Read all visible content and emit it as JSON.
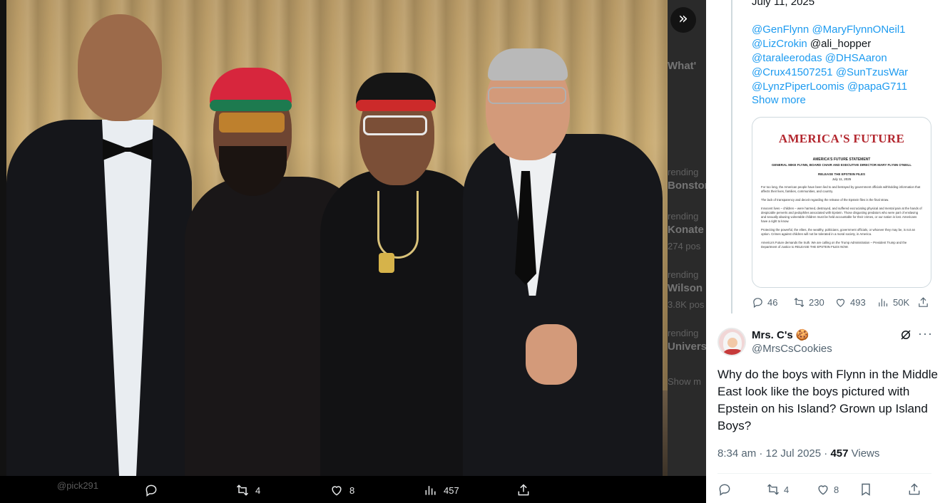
{
  "viewer": {
    "expand_icon": "chevrons-right-icon",
    "background_ghost": {
      "whats": "What'",
      "items": [
        {
          "line1": "rending",
          "line2": "Bonston"
        },
        {
          "line1": "rending",
          "line2": "Konate",
          "line3": "274 pos"
        },
        {
          "line1": "rending",
          "line2": "Wilson",
          "line3": "3.8K pos"
        },
        {
          "line1": "rending",
          "line2": "Univers"
        }
      ],
      "show": "Show m",
      "handle": "@pick291"
    },
    "bottom_bar": {
      "reply_icon": "reply-icon",
      "reply_count": "",
      "retweet_icon": "retweet-icon",
      "retweet_count": "4",
      "like_icon": "heart-icon",
      "like_count": "8",
      "views_icon": "views-icon",
      "views_count": "457",
      "share_icon": "share-icon"
    }
  },
  "parent_tweet": {
    "date": "July 11, 2025",
    "mentions": [
      "@GenFlynn",
      "@MaryFlynnONeil1",
      "@LizCrokin",
      "@ali_hopper",
      "@taraleerodas",
      "@DHSAaron",
      "@Crux41507251",
      "@SunTzusWar",
      "@LynzPiperLoomis",
      "@papaG711"
    ],
    "show_more": "Show more",
    "card": {
      "logo": "AMERICA'S FUTURE",
      "heading1": "AMERICA'S FUTURE STATEMENT",
      "heading2": "GENERAL MIKE FLYNN, BOARD CHAIR AND EXECUTIVE DIRECTOR MARY FLYNN O'NEILL",
      "heading3": "RELEASE THE EPSTEIN FILES",
      "heading4": "July 11, 2025",
      "paragraphs": [
        "For too long, the American people have been lied to and betrayed by government officials withholding information that affects their lives, families, communities, and country.",
        "The lack of transparency and deceit regarding the release of the Epstein files is the final straw.",
        "Innocent lives – children – were harmed, destroyed, and suffered excruciating physical and mental pain at the hands of despicable perverts and pedophiles associated with Epstein. Those disgusting predators who were part of enslaving and sexually abusing vulnerable children must be held accountable for their crimes, or our nation is lost. Americans have a right to know.",
        "Protecting the powerful, the elites, the wealthy, politicians, government officials, or whoever they may be, is not an option. Crimes against children will not be tolerated in a moral society, in America.",
        "America's Future demands the truth. We are calling on the Trump Administration – President Trump and the Department of Justice to RELEASE THE EPSTEIN FILES NOW."
      ]
    },
    "stats": {
      "replies": "46",
      "retweets": "230",
      "likes": "493",
      "views": "50K"
    }
  },
  "reply": {
    "name": "Mrs. C's 🍪",
    "handle": "@MrsCsCookies",
    "text": "Why do the boys with Flynn in the Middle East look like the boys pictured with Epstein on his Island? Grown up Island Boys?",
    "time": "8:34 am · 12 Jul 2025 · ",
    "views_num": "457",
    "views_label": " Views",
    "stats": {
      "retweets": "4",
      "likes": "8"
    }
  }
}
